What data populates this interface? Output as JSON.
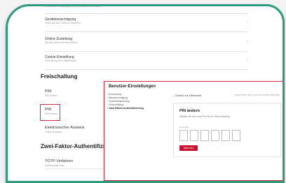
{
  "settings": {
    "top_items": [
      {
        "title": "",
        "subtitle": "Ihre Benachrichtigungen und Kontakt-Einstellungen"
      },
      {
        "title": "Geräteberechtigung",
        "subtitle": "Gebe auf das Gerät zu zugreifen"
      },
      {
        "title": "Online-Zustellung",
        "subtitle": "Auf das Konto kommunizieren"
      },
      {
        "title": "Cookie-Einstellung",
        "subtitle": "Verwaltung Ihrer Mitteilungen"
      }
    ],
    "freischaltung": {
      "title": "Freischaltung",
      "items": [
        {
          "title": "PIN",
          "subtitle": "PIN ändern"
        },
        {
          "title": "PIN",
          "subtitle": "PIN ändern"
        },
        {
          "title": "Elektronischer Ausweis",
          "subtitle": "Online-Ausweis"
        }
      ]
    },
    "two_factor": {
      "title": "Zwei-Faktor-Authentifizierung",
      "items": [
        {
          "title": "TOTP-Verfahren",
          "subtitle": "Authenticator App"
        }
      ]
    }
  },
  "popup": {
    "title": "Benutzer-Einstellungen",
    "menu": [
      "Anmeldung",
      "Benachrichtigung",
      "Sicherheitsprüfung",
      "Freischaltung",
      "Zwei-Faktor-Authentifizierung"
    ],
    "active_menu_index": 4,
    "back_label": "Zurück zur Übersicht",
    "grey_note": "Angemeldet als Kunde des Online-Bankings",
    "pin_title": "PIN ändern",
    "pin_description": "Wählen Sie eine neue PIN für Ihr Online-Banking",
    "pin_label": "Neue PIN",
    "save_label": "Speichern"
  },
  "colors": {
    "accent_red": "#c8102e",
    "frame_teal": "#2c9a7c"
  }
}
